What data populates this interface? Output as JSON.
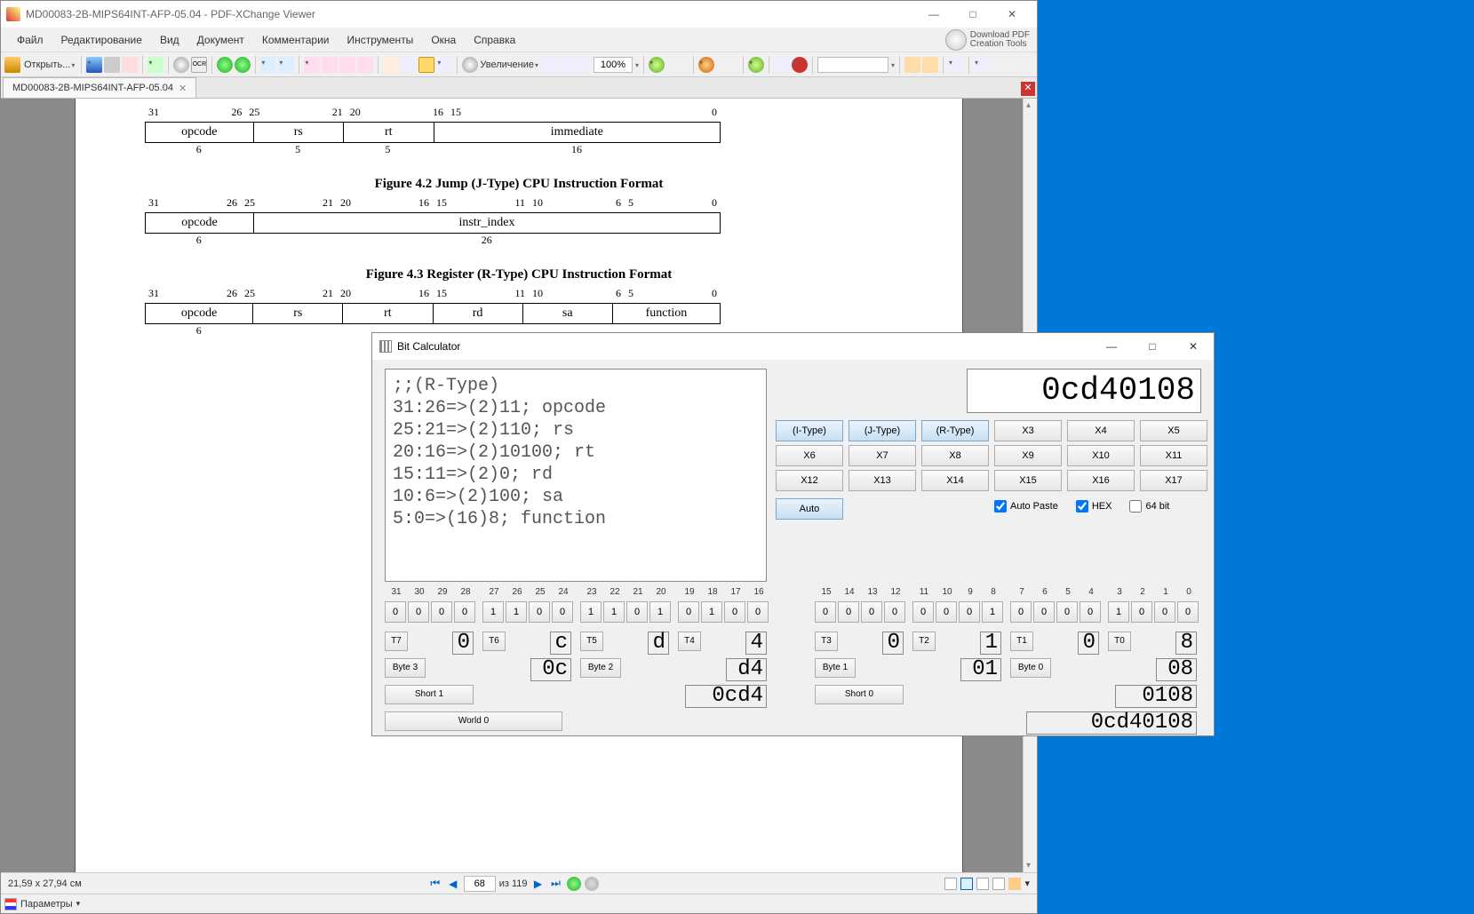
{
  "pdf": {
    "title": "MD00083-2B-MIPS64INT-AFP-05.04 - PDF-XChange Viewer",
    "menus": [
      "Файл",
      "Редактирование",
      "Вид",
      "Документ",
      "Комментарии",
      "Инструменты",
      "Окна",
      "Справка"
    ],
    "pdftools_l1": "Download PDF",
    "pdftools_l2": "Creation Tools",
    "open_label": "Открыть...",
    "zoom_label": "Увеличение",
    "zoom_value": "100%",
    "doc_tab": "MD00083-2B-MIPS64INT-AFP-05.04",
    "figures": {
      "i_type_bits_top": [
        "31",
        "26",
        "25",
        "21",
        "20",
        "16",
        "15",
        "0"
      ],
      "i_type_cells": [
        "opcode",
        "rs",
        "rt",
        "immediate"
      ],
      "i_type_widths": [
        "6",
        "5",
        "5",
        "16"
      ],
      "j_title": "Figure 4.2  Jump (J-Type) CPU Instruction Format",
      "j_bits_top": [
        "31",
        "26",
        "25",
        "21",
        "20",
        "16",
        "15",
        "11",
        "10",
        "6",
        "5",
        "0"
      ],
      "j_cells": [
        "opcode",
        "instr_index"
      ],
      "j_widths": [
        "6",
        "26"
      ],
      "r_title": "Figure 4.3  Register (R-Type) CPU Instruction Format",
      "r_bits_top": [
        "31",
        "26",
        "25",
        "21",
        "20",
        "16",
        "15",
        "11",
        "10",
        "6",
        "5",
        "0"
      ],
      "r_cells": [
        "opcode",
        "rs",
        "rt",
        "rd",
        "sa",
        "function"
      ],
      "r_widths": "6"
    },
    "status": {
      "size": "21,59 x 27,94 см",
      "page_cur": "68",
      "page_total": "из 119"
    },
    "params_label": "Параметры"
  },
  "calc": {
    "title": "Bit Calculator",
    "decoder_text": ";;(R-Type)\n31:26=>(2)11; opcode\n25:21=>(2)110; rs\n20:16=>(2)10100; rt\n15:11=>(2)0; rd\n10:6=>(2)100; sa\n5:0=>(16)8; function",
    "hex_full": "0cd40108",
    "xbuttons": [
      "(I-Type)",
      "(J-Type)",
      "(R-Type)",
      "X3",
      "X4",
      "X5",
      "X6",
      "X7",
      "X8",
      "X9",
      "X10",
      "X11",
      "X12",
      "X13",
      "X14",
      "X15",
      "X16",
      "X17"
    ],
    "xbuttons_selected": [
      "(I-Type)",
      "(J-Type)",
      "(R-Type)"
    ],
    "auto_label": "Auto",
    "chk_autopaste": "Auto Paste",
    "chk_hex": "HEX",
    "chk_64bit": "64 bit",
    "bits_high": [
      {
        "n": "31",
        "v": "0"
      },
      {
        "n": "30",
        "v": "0"
      },
      {
        "n": "29",
        "v": "0"
      },
      {
        "n": "28",
        "v": "0"
      },
      {
        "n": "27",
        "v": "1"
      },
      {
        "n": "26",
        "v": "1"
      },
      {
        "n": "25",
        "v": "0"
      },
      {
        "n": "24",
        "v": "0"
      },
      {
        "n": "23",
        "v": "1"
      },
      {
        "n": "22",
        "v": "1"
      },
      {
        "n": "21",
        "v": "0"
      },
      {
        "n": "20",
        "v": "1"
      },
      {
        "n": "19",
        "v": "0"
      },
      {
        "n": "18",
        "v": "1"
      },
      {
        "n": "17",
        "v": "0"
      },
      {
        "n": "16",
        "v": "0"
      }
    ],
    "bits_low": [
      {
        "n": "15",
        "v": "0"
      },
      {
        "n": "14",
        "v": "0"
      },
      {
        "n": "13",
        "v": "0"
      },
      {
        "n": "12",
        "v": "0"
      },
      {
        "n": "11",
        "v": "0"
      },
      {
        "n": "10",
        "v": "0"
      },
      {
        "n": "9",
        "v": "0"
      },
      {
        "n": "8",
        "v": "1"
      },
      {
        "n": "7",
        "v": "0"
      },
      {
        "n": "6",
        "v": "0"
      },
      {
        "n": "5",
        "v": "0"
      },
      {
        "n": "4",
        "v": "0"
      },
      {
        "n": "3",
        "v": "1"
      },
      {
        "n": "2",
        "v": "0"
      },
      {
        "n": "1",
        "v": "0"
      },
      {
        "n": "0",
        "v": "0"
      }
    ],
    "nibbles": [
      {
        "btn": "T7",
        "val": "0"
      },
      {
        "btn": "T6",
        "val": "c"
      },
      {
        "btn": "T5",
        "val": "d"
      },
      {
        "btn": "T4",
        "val": "4"
      },
      {
        "btn": "T3",
        "val": "0"
      },
      {
        "btn": "T2",
        "val": "1"
      },
      {
        "btn": "T1",
        "val": "0"
      },
      {
        "btn": "T0",
        "val": "8"
      }
    ],
    "bytes": [
      {
        "btn": "Byte 3",
        "val": "0c"
      },
      {
        "btn": "Byte 2",
        "val": "d4"
      },
      {
        "btn": "Byte 1",
        "val": "01"
      },
      {
        "btn": "Byte 0",
        "val": "08"
      }
    ],
    "shorts": [
      {
        "btn": "Short 1",
        "val": "0cd4"
      },
      {
        "btn": "Short 0",
        "val": "0108"
      }
    ],
    "word": {
      "btn": "World 0",
      "val": "0cd40108"
    }
  }
}
